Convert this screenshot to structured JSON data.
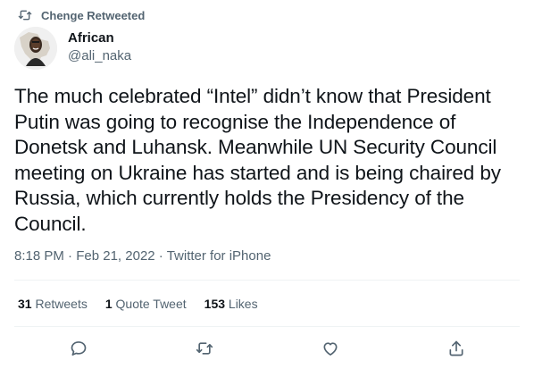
{
  "retweet_context": {
    "icon": "retweet-icon",
    "text": "Chenge Retweeted"
  },
  "author": {
    "display_name": "African",
    "handle": "@ali_naka"
  },
  "tweet": {
    "text": "The much celebrated “Intel” didn’t know that President Putin was going to recognise the Independence of Donetsk and Luhansk. Meanwhile UN Security Council meeting on Ukraine has started and is being chaired by Russia, which currently holds the Presidency of the Council.",
    "time": "8:18 PM",
    "date": "Feb 21, 2022",
    "source": "Twitter for iPhone",
    "separator": "·"
  },
  "stats": {
    "retweets_count": "31",
    "retweets_label": "Retweets",
    "quotes_count": "1",
    "quotes_label": "Quote Tweet",
    "likes_count": "153",
    "likes_label": "Likes"
  },
  "actions": [
    "reply-icon",
    "retweet-icon",
    "like-icon",
    "share-icon"
  ],
  "colors": {
    "text": "#0f1419",
    "secondary": "#536471",
    "divider": "#eff3f4"
  }
}
